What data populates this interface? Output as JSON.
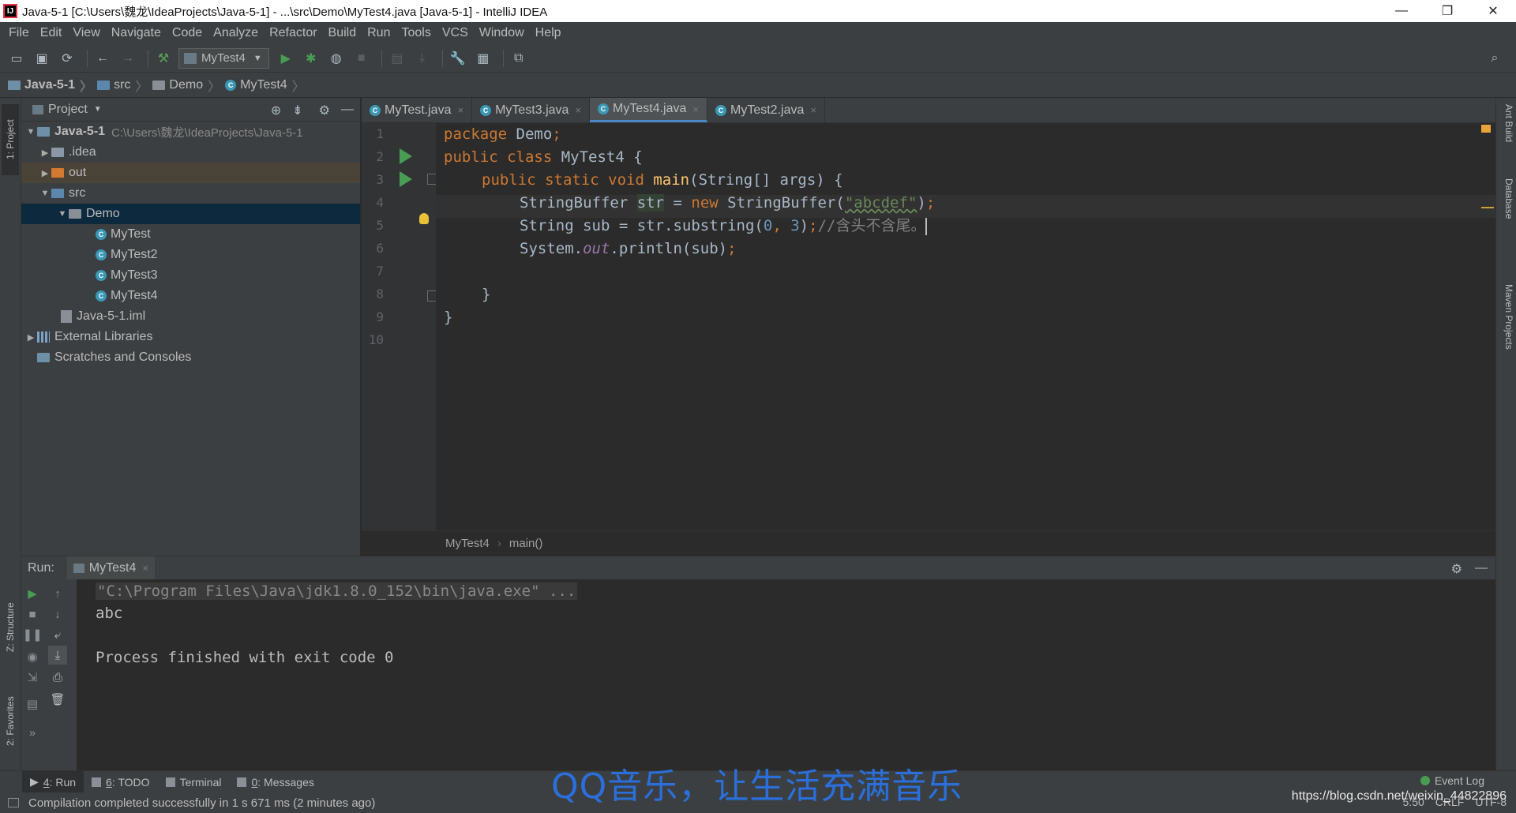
{
  "window": {
    "title": "Java-5-1 [C:\\Users\\魏龙\\IdeaProjects\\Java-5-1] - ...\\src\\Demo\\MyTest4.java [Java-5-1] - IntelliJ IDEA",
    "app_icon": "intellij-icon",
    "controls": {
      "minimize": "—",
      "restore": "❐",
      "close": "✕"
    }
  },
  "menu": [
    "File",
    "Edit",
    "View",
    "Navigate",
    "Code",
    "Analyze",
    "Refactor",
    "Build",
    "Run",
    "Tools",
    "VCS",
    "Window",
    "Help"
  ],
  "toolbar": {
    "run_config": "MyTest4",
    "icons": [
      "open-icon",
      "save-icon",
      "sync-icon",
      "back-icon",
      "forward-icon",
      "build-hammer-icon",
      "run-icon",
      "debug-icon",
      "coverage-icon",
      "stop-icon",
      "vcs-update-icon",
      "vcs-commit-icon",
      "settings-wrench-icon",
      "project-structure-icon",
      "sdk-icon",
      "search-icon"
    ]
  },
  "navbar": {
    "crumbs": [
      "Java-5-1",
      "src",
      "Demo",
      "MyTest4"
    ]
  },
  "left_stripe": {
    "project_tab": "1: Project",
    "structure_tab": "Z: Structure",
    "favorites_tab": "2: Favorites"
  },
  "right_stripe": {
    "tabs": [
      "Ant Build",
      "Database",
      "Maven Projects"
    ]
  },
  "project_panel": {
    "title": "Project",
    "tree": [
      {
        "label": "Java-5-1",
        "path": "C:\\Users\\魏龙\\IdeaProjects\\Java-5-1"
      },
      {
        "label": ".idea"
      },
      {
        "label": "out"
      },
      {
        "label": "src"
      },
      {
        "label": "Demo"
      },
      {
        "label": "MyTest"
      },
      {
        "label": "MyTest2"
      },
      {
        "label": "MyTest3"
      },
      {
        "label": "MyTest4"
      },
      {
        "label": "Java-5-1.iml"
      },
      {
        "label": "External Libraries"
      },
      {
        "label": "Scratches and Consoles"
      }
    ]
  },
  "editor": {
    "tabs": [
      "MyTest.java",
      "MyTest3.java",
      "MyTest4.java",
      "MyTest2.java"
    ],
    "active_tab": "MyTest4.java",
    "line_numbers": [
      "1",
      "2",
      "3",
      "4",
      "5",
      "6",
      "7",
      "8",
      "9",
      "10"
    ],
    "code": {
      "l1_kw": "package",
      "l1_rest": " Demo",
      "l1_semi": ";",
      "l2_kw": "public class",
      "l2_rest": " MyTest4 {",
      "l3_kw": "public static void",
      "l3_fn": "main",
      "l3_rest": "(String[] args) {",
      "l4_type": "StringBuffer ",
      "l4_var": "str",
      "l4_eq": " = ",
      "l4_new": "new",
      "l4_call": " StringBuffer(",
      "l4_str": "\"abcdef\"",
      "l4_close": ")",
      "l4_semi": ";",
      "l5_a": "String sub = str.substring(",
      "l5_n0": "0",
      "l5_comma": ", ",
      "l5_n3": "3",
      "l5_close": ")",
      "l5_semi": ";",
      "l5_cmt": "//含头不含尾。",
      "l6_a": "System.",
      "l6_out": "out",
      "l6_b": ".println(sub)",
      "l6_semi": ";",
      "l8": "}",
      "l9": "}"
    },
    "breadcrumbs": [
      "MyTest4",
      "main()"
    ]
  },
  "run_panel": {
    "label": "Run:",
    "tab": "MyTest4",
    "console": [
      "\"C:\\Program Files\\Java\\jdk1.8.0_152\\bin\\java.exe\" ...",
      "abc",
      "",
      "Process finished with exit code 0"
    ]
  },
  "bottom_bar": {
    "tabs": [
      {
        "num": "4",
        "label": ": Run"
      },
      {
        "num": "6",
        "label": ": TODO"
      },
      {
        "num": "",
        "label": "Terminal"
      },
      {
        "num": "0",
        "label": ": Messages"
      }
    ],
    "event_log": "Event Log"
  },
  "status_bar": {
    "message": "Compilation completed successfully in 1 s 671 ms (2 minutes ago)",
    "position": "5:50",
    "line_sep": "CRLF",
    "encoding": "UTF-8"
  },
  "watermarks": {
    "qq": "QQ音乐，让生活充满音乐",
    "csdn": "https://blog.csdn.net/weixin_44822896"
  },
  "colors": {
    "accent_tab": "#4a88c7",
    "run_green": "#499c54",
    "keyword": "#cc7832",
    "string": "#6a8759",
    "number": "#6897bb",
    "comment": "#808080",
    "selection": "#0d293e"
  }
}
